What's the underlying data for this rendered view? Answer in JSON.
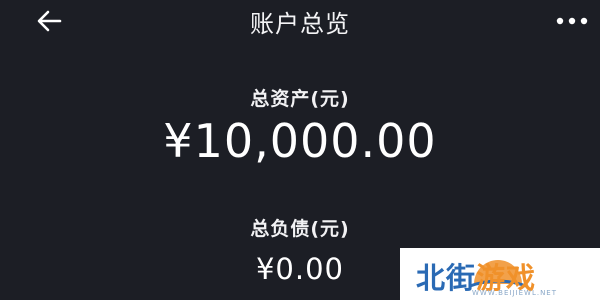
{
  "header": {
    "title": "账户总览",
    "back_icon": "arrow-left-icon",
    "more_icon": "more-dots-icon"
  },
  "summary": {
    "total_assets_label": "总资产(元)",
    "total_assets_value": "¥10,000.00",
    "total_liabilities_label": "总负债(元)",
    "total_liabilities_value": "¥0.00"
  },
  "watermark": {
    "brand_part1": "北街",
    "brand_part2": "游戏",
    "domain": "WWW.BEIJIEWL.NET"
  },
  "colors": {
    "background": "#1c1e25",
    "text": "#ffffff",
    "watermark_blue": "#2a6ab4",
    "watermark_orange": "#f0912a"
  }
}
